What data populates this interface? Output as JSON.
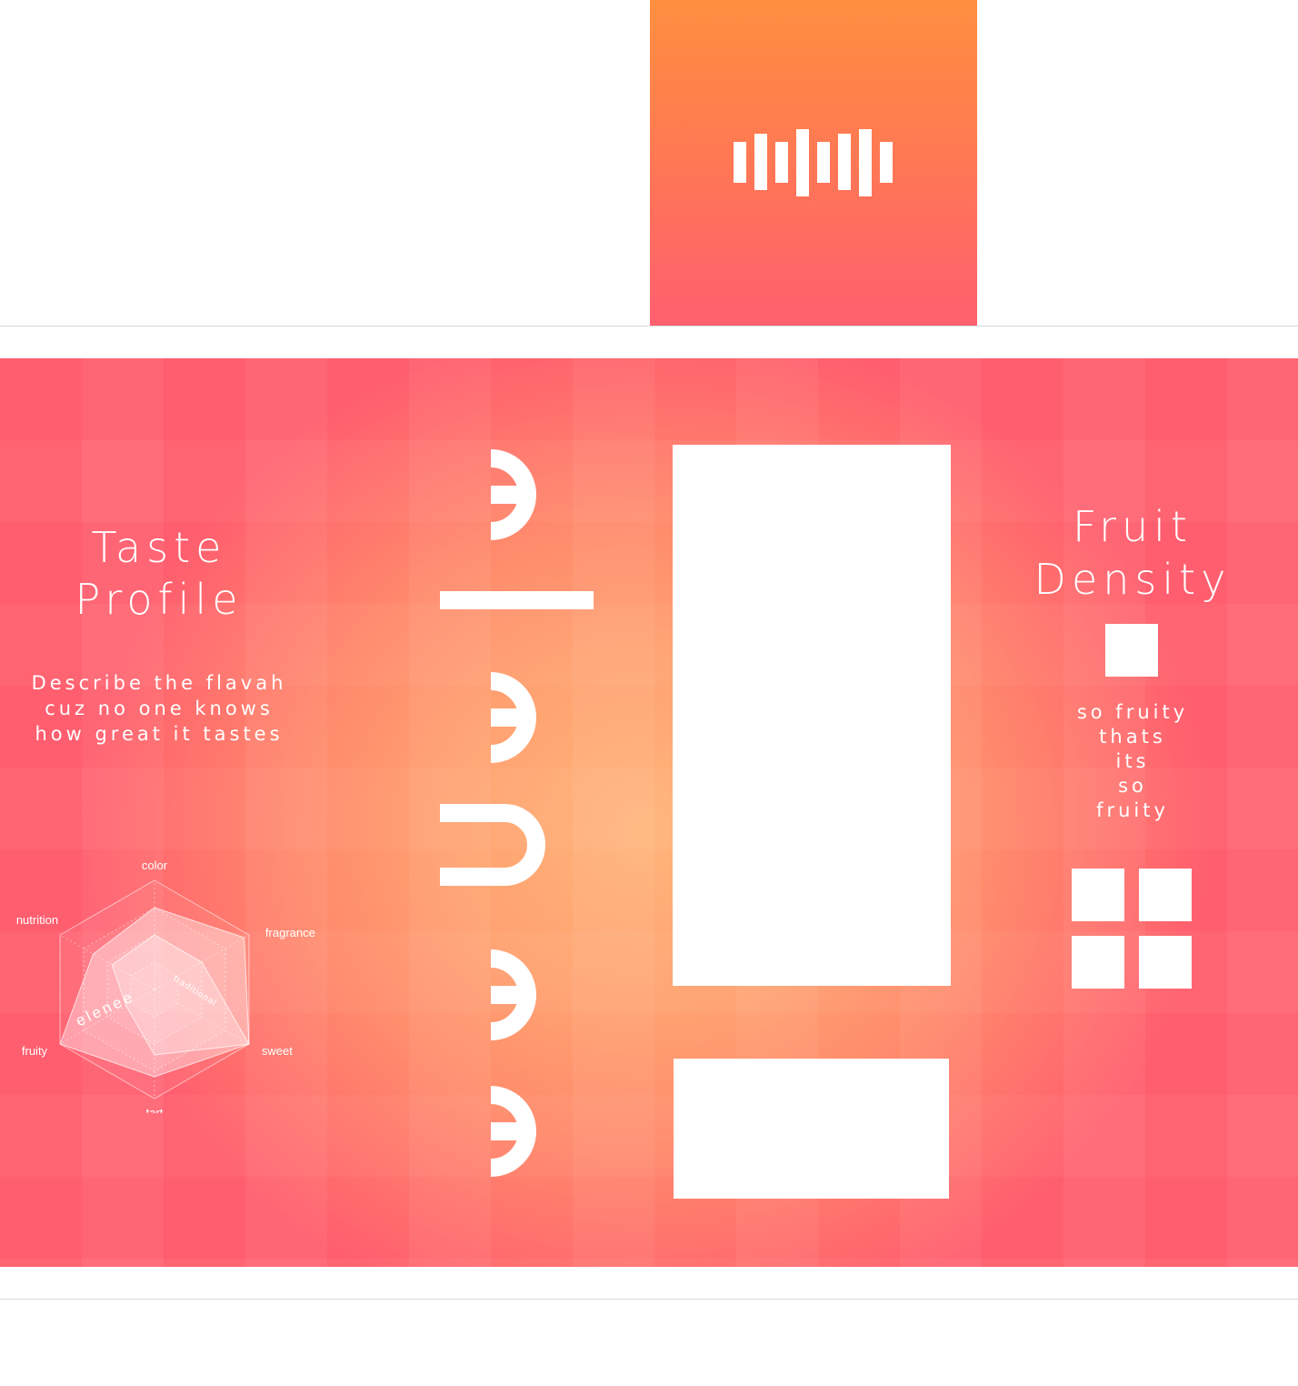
{
  "brand": {
    "name": "elenee",
    "letters": [
      "e",
      "l",
      "e",
      "n",
      "e",
      "e"
    ]
  },
  "taste_profile": {
    "title_line1": "Taste",
    "title_line2": "Profile",
    "description_lines": [
      "Describe the flavah",
      "cuz no one knows",
      "how great it tastes"
    ]
  },
  "fruit_density": {
    "title_line1": "Fruit",
    "title_line2": "Density",
    "description_lines": [
      "so fruity",
      "thats",
      "its",
      "so",
      "fruity"
    ]
  },
  "chart_data": {
    "type": "radar",
    "axes": [
      "color",
      "fragrance",
      "sweet",
      "tart",
      "fruity",
      "nutrition"
    ],
    "rmax": 10,
    "series": [
      {
        "name": "elenee",
        "values": [
          7.5,
          9.5,
          10,
          8,
          10,
          6.5
        ]
      },
      {
        "name": "traditional",
        "values": [
          5,
          5,
          10,
          6,
          3,
          4.5
        ]
      }
    ]
  },
  "colors": {
    "panel_center": "#ffb57a",
    "panel_edge": "#ff5e6e",
    "flap_top": "#ff8f3f",
    "flap_bottom": "#ff5f6f",
    "foreground": "#ffffff"
  },
  "icons": [
    "barcode-icon",
    "single-square-icon",
    "four-squares-icon"
  ]
}
